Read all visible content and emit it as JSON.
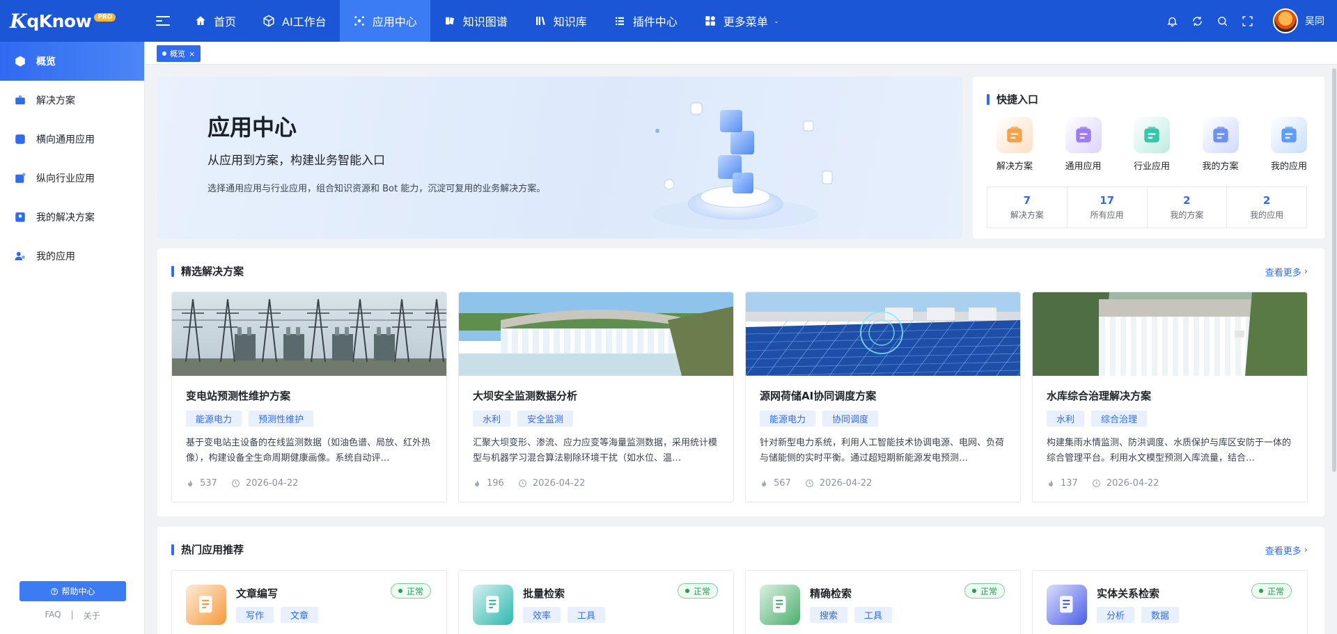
{
  "app": {
    "logo_mark": "K",
    "name": "qKnow",
    "badge": "PRO"
  },
  "nav": {
    "items": [
      {
        "label": "首页",
        "icon": "home-icon"
      },
      {
        "label": "AI工作台",
        "icon": "cube-icon"
      },
      {
        "label": "应用中心",
        "icon": "app-center-icon",
        "active": true
      },
      {
        "label": "知识图谱",
        "icon": "graph-icon"
      },
      {
        "label": "知识库",
        "icon": "books-icon"
      },
      {
        "label": "插件中心",
        "icon": "plugin-icon"
      },
      {
        "label": "更多菜单",
        "icon": "grid-icon",
        "has_caret": true
      }
    ]
  },
  "user": {
    "name": "吴同"
  },
  "sidebar": {
    "items": [
      {
        "label": "概览",
        "icon": "overview-icon",
        "active": true
      },
      {
        "label": "解决方案",
        "icon": "briefcase-icon"
      },
      {
        "label": "横向通用应用",
        "icon": "apps-icon"
      },
      {
        "label": "纵向行业应用",
        "icon": "industry-icon"
      },
      {
        "label": "我的解决方案",
        "icon": "my-solution-icon"
      },
      {
        "label": "我的应用",
        "icon": "user-app-icon"
      }
    ],
    "help_label": "帮助中心",
    "links": [
      "FAQ",
      "|",
      "关于"
    ]
  },
  "tabs": [
    {
      "label": "概览"
    }
  ],
  "hero": {
    "title": "应用中心",
    "subtitle": "从应用到方案，构建业务智能入口",
    "description": "选择通用应用与行业应用，组合知识资源和 Bot 能力，沉淀可复用的业务解决方案。"
  },
  "quick": {
    "title": "快捷入口",
    "items": [
      {
        "label": "解决方案",
        "icon": "solution-icon",
        "color": "#f5a04a"
      },
      {
        "label": "通用应用",
        "icon": "general-app-icon",
        "color": "#9b7df2"
      },
      {
        "label": "行业应用",
        "icon": "industry-app-icon",
        "color": "#3cc3a8"
      },
      {
        "label": "我的方案",
        "icon": "my-plan-icon",
        "color": "#6f8ff3"
      },
      {
        "label": "我的应用",
        "icon": "my-app-icon",
        "color": "#5e9cf7"
      }
    ],
    "stats": [
      {
        "value": "7",
        "label": "解决方案"
      },
      {
        "value": "17",
        "label": "所有应用"
      },
      {
        "value": "2",
        "label": "我的方案"
      },
      {
        "value": "2",
        "label": "我的应用"
      }
    ]
  },
  "featured": {
    "title": "精选解决方案",
    "more": "查看更多",
    "cards": [
      {
        "title": "变电站预测性维护方案",
        "tags": [
          "能源电力",
          "预测性维护"
        ],
        "desc": "基于变电站主设备的在线监测数据（如油色谱、局放、红外热像），构建设备全生命周期健康画像。系统自动评…",
        "views": "537",
        "date": "2026-04-22",
        "scene": "substation"
      },
      {
        "title": "大坝安全监测数据分析",
        "tags": [
          "水利",
          "安全监测"
        ],
        "desc": "汇聚大坝变形、渗流、应力应变等海量监测数据，采用统计模型与机器学习混合算法剔除环境干扰（如水位、温…",
        "views": "196",
        "date": "2026-04-22",
        "scene": "dam"
      },
      {
        "title": "源网荷储AI协同调度方案",
        "tags": [
          "能源电力",
          "协同调度"
        ],
        "desc": "针对新型电力系统，利用人工智能技术协调电源、电网、负荷与储能侧的实时平衡。通过超短期新能源发电预测…",
        "views": "567",
        "date": "2026-04-22",
        "scene": "solar"
      },
      {
        "title": "水库综合治理解决方案",
        "tags": [
          "水利",
          "综合治理"
        ],
        "desc": "构建集雨水情监测、防洪调度、水质保护与库区安防于一体的综合管理平台。利用水文模型预测入库流量，结合…",
        "views": "137",
        "date": "2026-04-22",
        "scene": "reservoir"
      }
    ]
  },
  "hot": {
    "title": "热门应用推荐",
    "more": "查看更多",
    "apps": [
      {
        "name": "文章编写",
        "status": "正常",
        "tags": [
          "写作",
          "文章"
        ],
        "icon": "article-writing-icon",
        "color": "#f59a3c"
      },
      {
        "name": "批量检索",
        "status": "正常",
        "tags": [
          "效率",
          "工具"
        ],
        "icon": "batch-search-icon",
        "color": "#2fb8b0"
      },
      {
        "name": "精确检索",
        "status": "正常",
        "tags": [
          "搜索",
          "工具"
        ],
        "icon": "precise-search-icon",
        "color": "#4caf6e"
      },
      {
        "name": "实体关系检索",
        "status": "正常",
        "tags": [
          "分析",
          "数据"
        ],
        "icon": "entity-relation-icon",
        "color": "#4a5de8"
      }
    ]
  }
}
